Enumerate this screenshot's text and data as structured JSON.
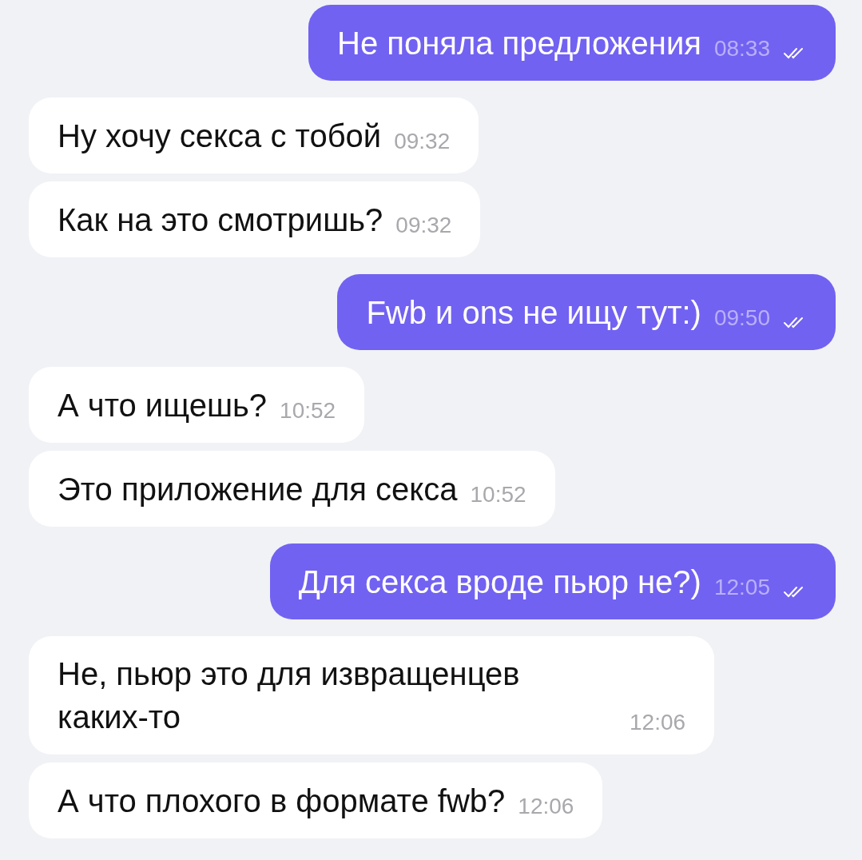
{
  "messages": [
    {
      "kind": "outgoing",
      "text": "Не поняла предложения",
      "time": "08:33",
      "read": true
    },
    {
      "kind": "incoming",
      "text": "Ну хочу секса с тобой",
      "time": "09:32"
    },
    {
      "kind": "incoming",
      "text": "Как на это смотришь?",
      "time": "09:32"
    },
    {
      "kind": "outgoing",
      "text": "Fwb и ons не ищу тут:)",
      "time": "09:50",
      "read": true
    },
    {
      "kind": "incoming",
      "text": "А что ищешь?",
      "time": "10:52"
    },
    {
      "kind": "incoming",
      "text": "Это приложение для секса",
      "time": "10:52"
    },
    {
      "kind": "outgoing",
      "text": "Для секса вроде пьюр не?)",
      "time": "12:05",
      "read": true
    },
    {
      "kind": "incoming",
      "text": "Не, пьюр это для извращенцев каких-то",
      "time": "12:06"
    },
    {
      "kind": "incoming",
      "text": "А что плохого в формате fwb?",
      "time": "12:06"
    }
  ]
}
